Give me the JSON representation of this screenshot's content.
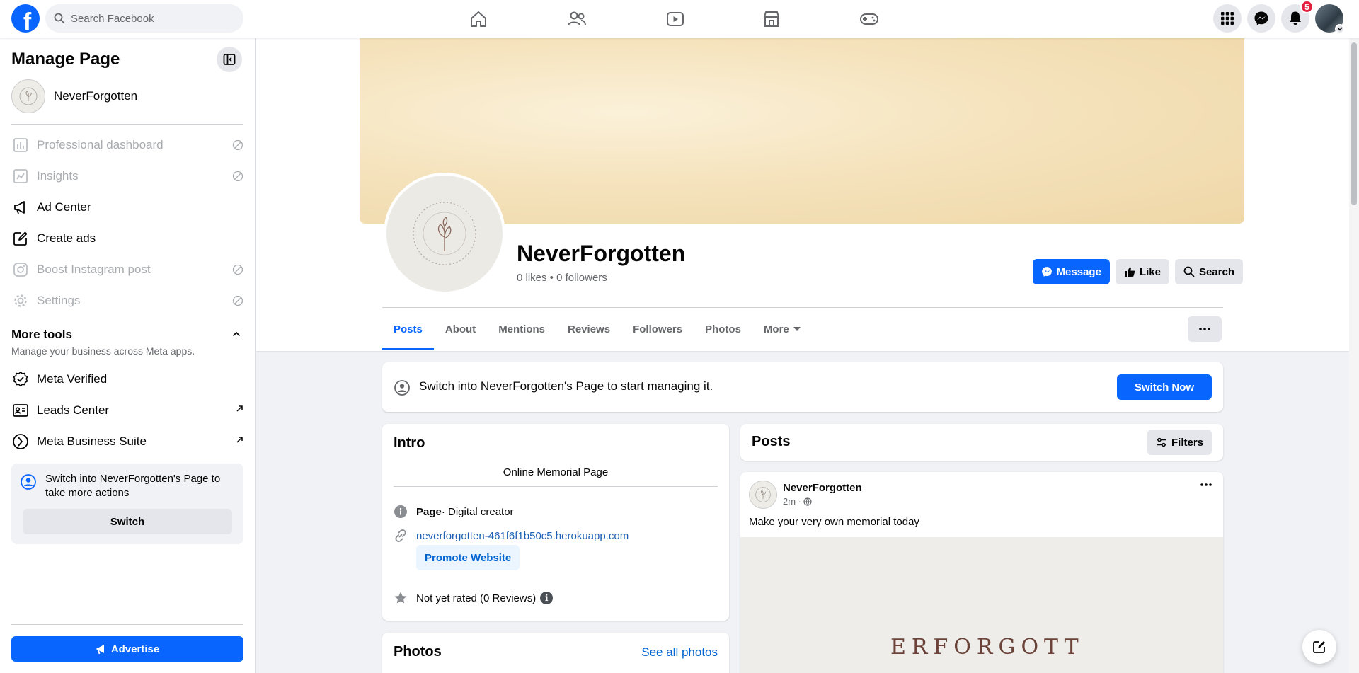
{
  "topbar": {
    "search_placeholder": "Search Facebook",
    "logo_letter": "f",
    "notifications_count": "5"
  },
  "sidebar": {
    "title": "Manage Page",
    "page_name": "NeverForgotten",
    "items": [
      {
        "label": "Professional dashboard",
        "icon": "dashboard-icon",
        "disabled": true
      },
      {
        "label": "Insights",
        "icon": "insights-icon",
        "disabled": true
      },
      {
        "label": "Ad Center",
        "icon": "megaphone-icon",
        "disabled": false
      },
      {
        "label": "Create ads",
        "icon": "pencil-square-icon",
        "disabled": false
      },
      {
        "label": "Boost Instagram post",
        "icon": "instagram-icon",
        "disabled": true
      },
      {
        "label": "Settings",
        "icon": "gear-icon",
        "disabled": true
      }
    ],
    "more_tools": {
      "title": "More tools",
      "subtitle": "Manage your business across Meta apps.",
      "items": [
        {
          "label": "Meta Verified",
          "icon": "verified-badge-icon"
        },
        {
          "label": "Leads Center",
          "icon": "id-card-icon"
        },
        {
          "label": "Meta Business Suite",
          "icon": "meta-business-suite-icon"
        }
      ]
    },
    "switch_card": {
      "text": "Switch into NeverForgotten's Page to take more actions",
      "button": "Switch"
    },
    "advertise": "Advertise"
  },
  "page": {
    "name": "NeverForgotten",
    "stats": "0 likes • 0 followers",
    "buttons": {
      "message": "Message",
      "like": "Like",
      "search": "Search"
    },
    "tabs": [
      "Posts",
      "About",
      "Mentions",
      "Reviews",
      "Followers",
      "Photos",
      "More"
    ],
    "notice": {
      "text": "Switch into NeverForgotten's Page to start managing it.",
      "button": "Switch Now"
    },
    "intro": {
      "title": "Intro",
      "bio": "Online Memorial Page",
      "category_bold": "Page",
      "category": " · Digital creator",
      "website": "neverforgotten-461f6f1b50c5.herokuapp.com",
      "promote": "Promote Website",
      "rating": "Not yet rated (0 Reviews)"
    },
    "photos": {
      "title": "Photos",
      "see_all": "See all photos"
    },
    "posts": {
      "title": "Posts",
      "filters": "Filters"
    },
    "post": {
      "author": "NeverForgotten",
      "time": "2m ·",
      "text": "Make your very own memorial today",
      "image_letters": "ERFORGOTT"
    }
  },
  "colors": {
    "accent": "#0866ff",
    "badge": "#e41e3f"
  }
}
